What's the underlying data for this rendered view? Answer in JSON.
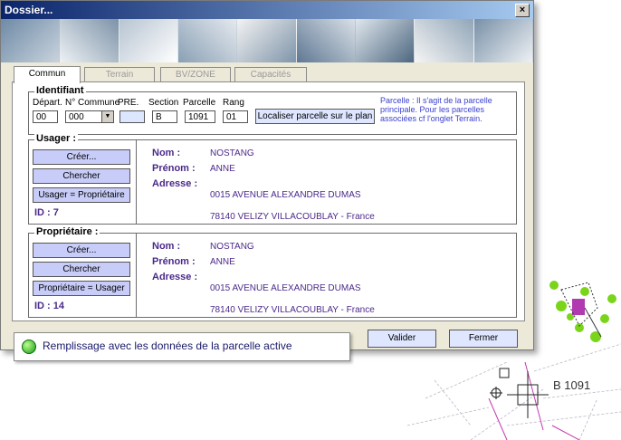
{
  "window": {
    "title": "Dossier...",
    "close_label": "×"
  },
  "tabs": [
    {
      "label": "Commun",
      "active": true
    },
    {
      "label": "Terrain",
      "active": false
    },
    {
      "label": "BV/ZONE",
      "active": false
    },
    {
      "label": "Capacités",
      "active": false
    }
  ],
  "identifiant": {
    "legend": "Identifiant",
    "labels": {
      "depart": "Départ.",
      "commune": "N° Commune",
      "pre": "PRE.",
      "section": "Section",
      "parcelle": "Parcelle",
      "rang": "Rang"
    },
    "values": {
      "depart": "00",
      "commune": "000",
      "pre": "",
      "section": "B",
      "parcelle": "1091",
      "rang": "01"
    },
    "locate_button": "Localiser parcelle sur le plan",
    "note": "Parcelle : Il s'agit de la parcelle principale. Pour les parcelles associées cf l'onglet Terrain."
  },
  "usager": {
    "legend": "Usager :",
    "buttons": {
      "create": "Créer...",
      "search": "Chercher",
      "copy": "Usager = Propriétaire"
    },
    "id_label": "ID :",
    "id_value": "7",
    "nom_label": "Nom :",
    "nom": "NOSTANG",
    "prenom_label": "Prénom :",
    "prenom": "ANNE",
    "adresse_label": "Adresse :",
    "adresse1": "0015 AVENUE ALEXANDRE DUMAS",
    "adresse2": "78140 VELIZY VILLACOUBLAY - France"
  },
  "proprietaire": {
    "legend": "Propriétaire :",
    "buttons": {
      "create": "Créer...",
      "search": "Chercher",
      "copy": "Propriétaire = Usager"
    },
    "id_label": "ID :",
    "id_value": "14",
    "nom_label": "Nom :",
    "nom": "NOSTANG",
    "prenom_label": "Prénom :",
    "prenom": "ANNE",
    "adresse_label": "Adresse :",
    "adresse1": "0015 AVENUE ALEXANDRE DUMAS",
    "adresse2": "78140 VELIZY VILLACOUBLAY - France"
  },
  "footer": {
    "validate": "Valider",
    "close": "Fermer"
  },
  "status": {
    "message": "Remplissage avec les données de la parcelle active",
    "icon": "green-status-icon"
  },
  "map": {
    "parcel_label": "B 1091"
  },
  "colors": {
    "accent": "#4b2a8a",
    "button_lavender": "#c8ccf8",
    "title_bar": "#0a246a",
    "status_green": "#1a9a1a"
  }
}
